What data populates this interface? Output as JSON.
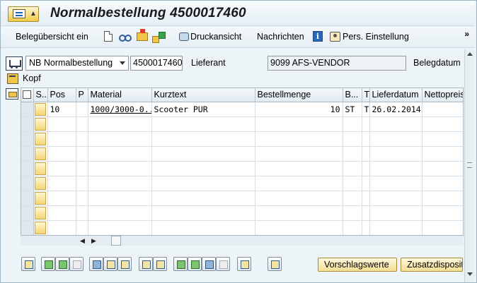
{
  "window": {
    "title": "Normalbestellung 4500017460"
  },
  "toolbar": {
    "beleguebersicht": "Belegübersicht ein",
    "druckansicht": "Druckansicht",
    "nachrichten": "Nachrichten",
    "pers_einstellung": "Pers. Einstellung",
    "more": "»"
  },
  "header": {
    "doc_type": "NB Normalbestellung",
    "doc_number": "4500017460",
    "lieferant_label": "Lieferant",
    "lieferant_value": "9099 AFS-VENDOR",
    "belegdatum_label": "Belegdatum",
    "kopf_label": "Kopf"
  },
  "grid": {
    "columns": [
      "S...",
      "Pos",
      "P",
      "Material",
      "Kurztext",
      "Bestellmenge",
      "B...",
      "T",
      "Lieferdatum",
      "Nettopreis"
    ],
    "rows": [
      {
        "pos": "10",
        "p": "",
        "material": "1000/3000-0...",
        "kurztext": "Scooter PUR",
        "menge": "10",
        "bme": "ST",
        "t": "T",
        "lieferdatum": "26.02.2014",
        "nettopreis": ""
      }
    ],
    "empty_rows": 8
  },
  "buttons": {
    "vorschlagswerte": "Vorschlagswerte",
    "zusatzdisposition": "Zusatzdisposit"
  }
}
